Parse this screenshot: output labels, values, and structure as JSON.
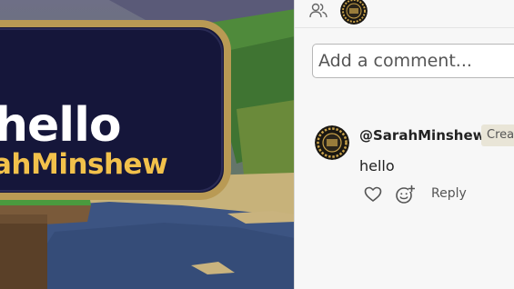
{
  "scene": {
    "sign_line1": "hello",
    "sign_line2": "ahMinshew",
    "colors": {
      "sign_bg": "#15163a",
      "sign_border": "#b99a54",
      "sign_text": "#ffffff",
      "sign_name": "#f2c14b",
      "water": "#3c5482",
      "grass": "#4f8a3b"
    }
  },
  "topbar": {
    "people_icon": "people-icon",
    "avatar_icon": "badge-avatar"
  },
  "comment_box": {
    "placeholder": "Add a comment..."
  },
  "comments": [
    {
      "author": "@SarahMinshew",
      "badge": "Creator",
      "text": "hello",
      "like_icon": "heart-icon",
      "react_icon": "emoji-add-icon",
      "reply_label": "Reply"
    }
  ]
}
